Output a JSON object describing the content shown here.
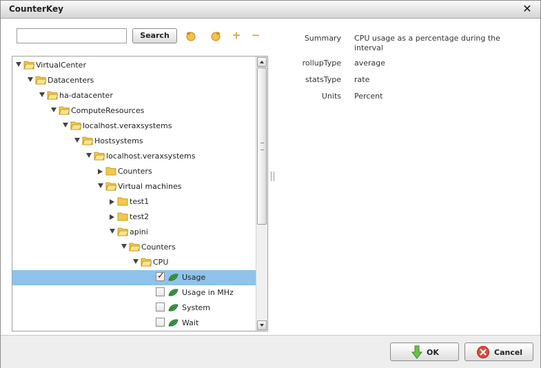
{
  "window": {
    "title": "CounterKey"
  },
  "toolbar": {
    "search_value": "",
    "search_button": "Search",
    "plus_label": "+",
    "minus_label": "−"
  },
  "tree": [
    {
      "label": "VirtualCenter",
      "level": 0,
      "expander": "open",
      "kind": "folder"
    },
    {
      "label": "Datacenters",
      "level": 1,
      "expander": "open",
      "kind": "folder"
    },
    {
      "label": "ha-datacenter",
      "level": 2,
      "expander": "open",
      "kind": "folder"
    },
    {
      "label": "ComputeResources",
      "level": 3,
      "expander": "open",
      "kind": "folder"
    },
    {
      "label": "localhost.veraxsystems",
      "level": 4,
      "expander": "open",
      "kind": "folder"
    },
    {
      "label": "Hostsystems",
      "level": 5,
      "expander": "open",
      "kind": "folder"
    },
    {
      "label": "localhost.veraxsystems",
      "level": 6,
      "expander": "open",
      "kind": "folder"
    },
    {
      "label": "Counters",
      "level": 7,
      "expander": "closed",
      "kind": "folder"
    },
    {
      "label": "Virtual machines",
      "level": 7,
      "expander": "open",
      "kind": "folder"
    },
    {
      "label": "test1",
      "level": 8,
      "expander": "closed",
      "kind": "folder"
    },
    {
      "label": "test2",
      "level": 8,
      "expander": "closed",
      "kind": "folder"
    },
    {
      "label": "apini",
      "level": 8,
      "expander": "open",
      "kind": "folder"
    },
    {
      "label": "Counters",
      "level": 9,
      "expander": "open",
      "kind": "folder"
    },
    {
      "label": "CPU",
      "level": 10,
      "expander": "open",
      "kind": "folder"
    },
    {
      "label": "Usage",
      "level": 11,
      "kind": "counter",
      "checked": true,
      "selected": true
    },
    {
      "label": "Usage in MHz",
      "level": 11,
      "kind": "counter",
      "checked": false
    },
    {
      "label": "System",
      "level": 11,
      "kind": "counter",
      "checked": false
    },
    {
      "label": "Wait",
      "level": 11,
      "kind": "counter",
      "checked": false
    }
  ],
  "properties": [
    {
      "key": "Summary",
      "value": "CPU usage as a percentage during the interval"
    },
    {
      "key": "rollupType",
      "value": "average"
    },
    {
      "key": "statsType",
      "value": "rate"
    },
    {
      "key": "Units",
      "value": "Percent"
    }
  ],
  "footer": {
    "ok_label": "OK",
    "cancel_label": "Cancel"
  },
  "colors": {
    "selection": "#8fc3ea",
    "folder": "#f5c842",
    "leaf": "#3aa040",
    "accent": "#e8a317"
  }
}
